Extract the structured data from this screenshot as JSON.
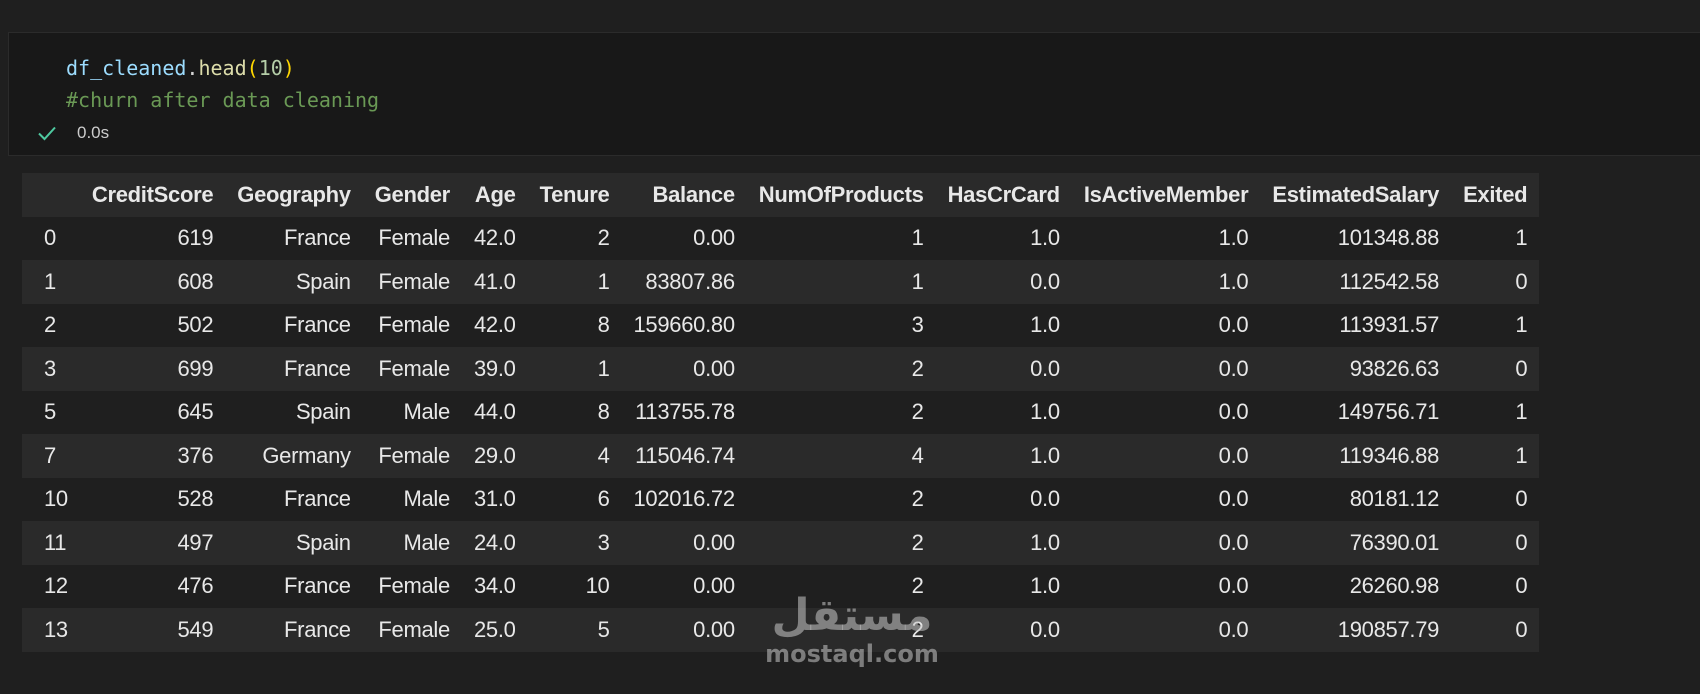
{
  "cell": {
    "code_var": "df_cleaned",
    "code_dot": ".",
    "code_fn": "head",
    "code_open": "(",
    "code_arg": "10",
    "code_close": ")",
    "comment": "#churn after data cleaning",
    "status_icon": "check-icon",
    "exec_time": "0.0s"
  },
  "table": {
    "columns": [
      "",
      "CreditScore",
      "Geography",
      "Gender",
      "Age",
      "Tenure",
      "Balance",
      "NumOfProducts",
      "HasCrCard",
      "IsActiveMember",
      "EstimatedSalary",
      "Exited"
    ],
    "rows": [
      [
        "0",
        "619",
        "France",
        "Female",
        "42.0",
        "2",
        "0.00",
        "1",
        "1.0",
        "1.0",
        "101348.88",
        "1"
      ],
      [
        "1",
        "608",
        "Spain",
        "Female",
        "41.0",
        "1",
        "83807.86",
        "1",
        "0.0",
        "1.0",
        "112542.58",
        "0"
      ],
      [
        "2",
        "502",
        "France",
        "Female",
        "42.0",
        "8",
        "159660.80",
        "3",
        "1.0",
        "0.0",
        "113931.57",
        "1"
      ],
      [
        "3",
        "699",
        "France",
        "Female",
        "39.0",
        "1",
        "0.00",
        "2",
        "0.0",
        "0.0",
        "93826.63",
        "0"
      ],
      [
        "5",
        "645",
        "Spain",
        "Male",
        "44.0",
        "8",
        "113755.78",
        "2",
        "1.0",
        "0.0",
        "149756.71",
        "1"
      ],
      [
        "7",
        "376",
        "Germany",
        "Female",
        "29.0",
        "4",
        "115046.74",
        "4",
        "1.0",
        "0.0",
        "119346.88",
        "1"
      ],
      [
        "10",
        "528",
        "France",
        "Male",
        "31.0",
        "6",
        "102016.72",
        "2",
        "0.0",
        "0.0",
        "80181.12",
        "0"
      ],
      [
        "11",
        "497",
        "Spain",
        "Male",
        "24.0",
        "3",
        "0.00",
        "2",
        "1.0",
        "0.0",
        "76390.01",
        "0"
      ],
      [
        "12",
        "476",
        "France",
        "Female",
        "34.0",
        "10",
        "0.00",
        "2",
        "1.0",
        "0.0",
        "26260.98",
        "0"
      ],
      [
        "13",
        "549",
        "France",
        "Female",
        "25.0",
        "5",
        "0.00",
        "2",
        "0.0",
        "0.0",
        "190857.79",
        "0"
      ]
    ]
  },
  "watermark": {
    "logo": "مستقل",
    "url": "mostaql.com"
  },
  "colors": {
    "background": "#1f1f1f",
    "cell_background": "#181818",
    "success_check": "#4ec9a0",
    "comment": "#6a9955"
  }
}
